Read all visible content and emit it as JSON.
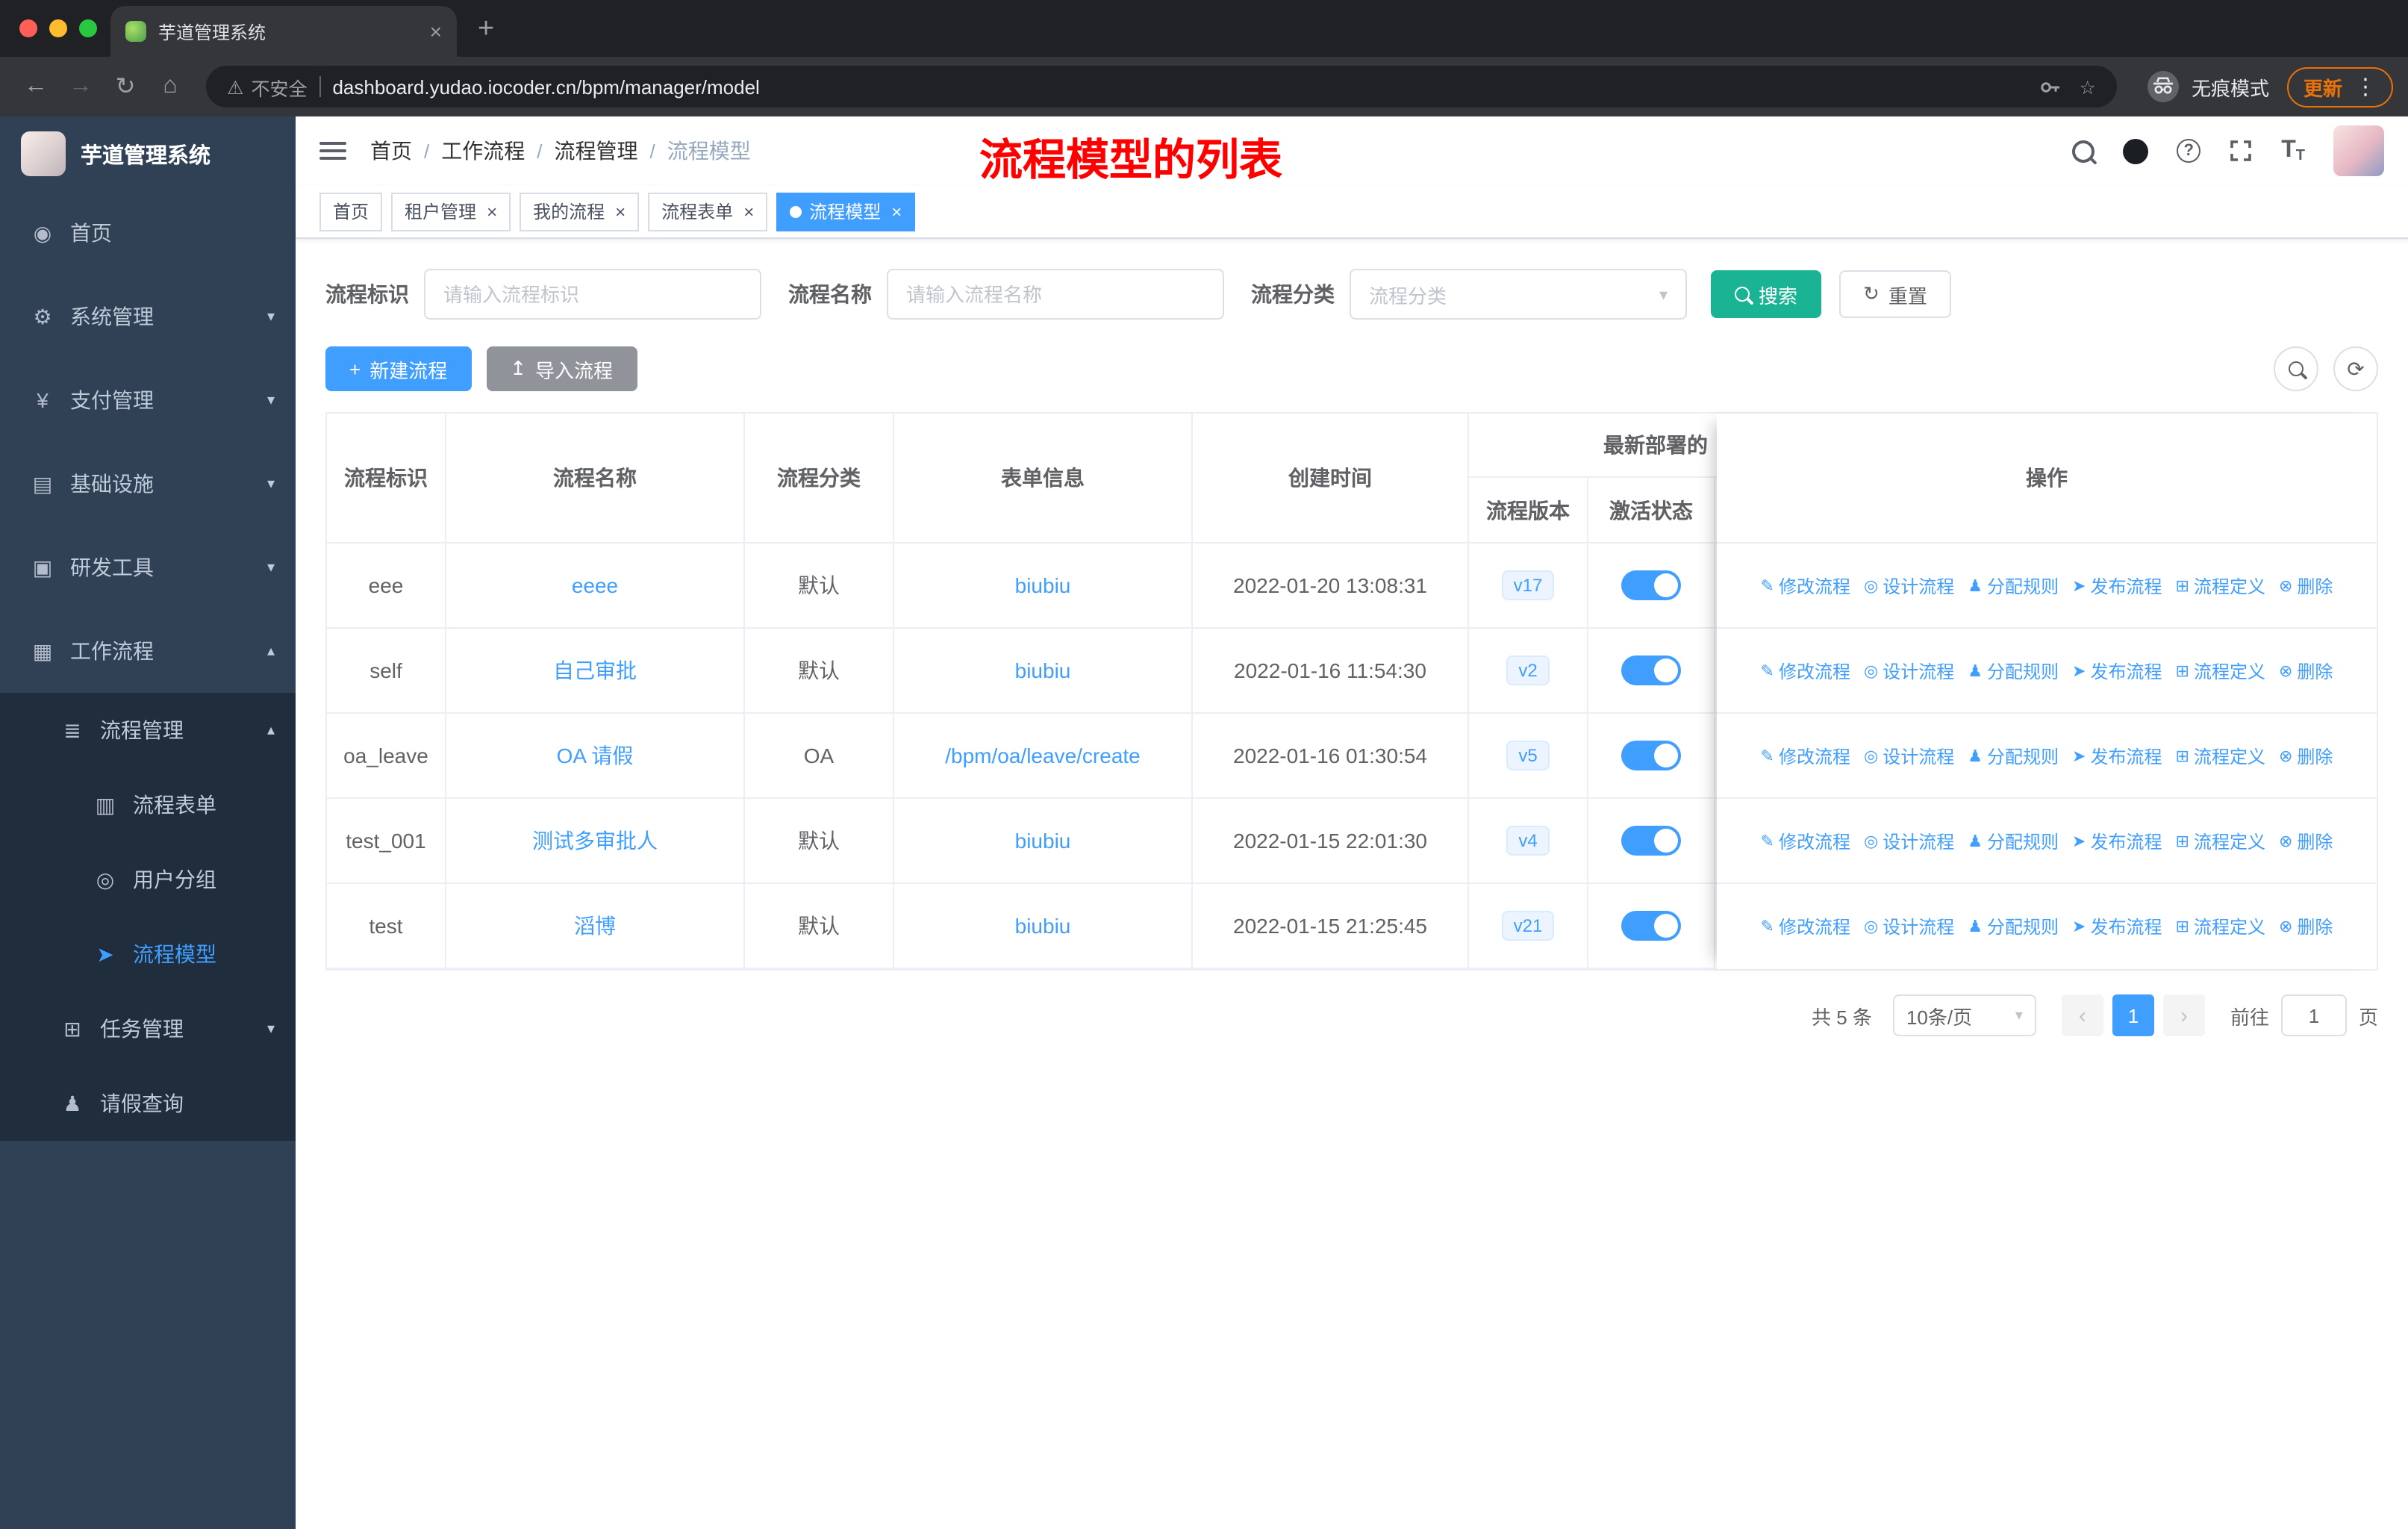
{
  "colors": {
    "accent": "#409eff",
    "search_button": "#1ab394",
    "annotation_red": "#ff0000",
    "sidebar_bg": "#304156",
    "sidebar_nested_bg": "#1f2d3d",
    "toggle_on": "#409eff",
    "tag_active": "#409eff"
  },
  "icons": {
    "dashboard": "◉",
    "gear": "⚙",
    "payment": "¥",
    "infrastructure": "▤",
    "devtools": "▣",
    "workflow": "▦",
    "process_management": "≣",
    "form": "▥",
    "user_group": "◎",
    "model": "➤",
    "task": "⊞",
    "person": "♟",
    "chevron_down": "▾",
    "chevron_up": "▴",
    "edit": "✎",
    "design": "◎",
    "assign": "♟",
    "publish": "➤",
    "definition": "⊞",
    "delete": "⊗",
    "plus": "+",
    "upload": "↥",
    "refresh": "⟳",
    "reset": "↻",
    "back": "←",
    "forward": "→",
    "reload": "↻",
    "home": "⌂",
    "warning": "⚠",
    "star": "☆",
    "dots": "⋮",
    "close": "×",
    "caret": "▾",
    "prev": "‹",
    "next": "›",
    "new_tab": "+",
    "question": "?",
    "font_size": "T"
  },
  "browser": {
    "tab_title": "芋道管理系统",
    "security_label": "不安全",
    "url": "dashboard.yudao.iocoder.cn/bpm/manager/model",
    "incognito_label": "无痕模式",
    "update_label": "更新"
  },
  "sidebar": {
    "app_title": "芋道管理系统",
    "menu": [
      {
        "label": "首页"
      },
      {
        "label": "系统管理"
      },
      {
        "label": "支付管理"
      },
      {
        "label": "基础设施"
      },
      {
        "label": "研发工具"
      },
      {
        "label": "工作流程"
      },
      {
        "label": "流程管理"
      },
      {
        "label": "流程表单"
      },
      {
        "label": "用户分组"
      },
      {
        "label": "流程模型"
      },
      {
        "label": "任务管理"
      },
      {
        "label": "请假查询"
      }
    ]
  },
  "header": {
    "breadcrumb": [
      "首页",
      "工作流程",
      "流程管理",
      "流程模型"
    ],
    "annotation": "流程模型的列表"
  },
  "tags": [
    {
      "label": "首页"
    },
    {
      "label": "租户管理"
    },
    {
      "label": "我的流程"
    },
    {
      "label": "流程表单"
    },
    {
      "label": "流程模型"
    }
  ],
  "filters": {
    "key_label": "流程标识",
    "key_placeholder": "请输入流程标识",
    "name_label": "流程名称",
    "name_placeholder": "请输入流程名称",
    "category_label": "流程分类",
    "category_placeholder": "流程分类",
    "search_label": "搜索",
    "reset_label": "重置"
  },
  "toolbar": {
    "create_label": "新建流程",
    "import_label": "导入流程"
  },
  "table": {
    "headers": {
      "id": "流程标识",
      "name": "流程名称",
      "category": "流程分类",
      "form": "表单信息",
      "created": "创建时间",
      "deploy_group": "最新部署的",
      "version": "流程版本",
      "status": "激活状态",
      "actions": "操作"
    },
    "rows": [
      {
        "id": "eee",
        "name": "eeee",
        "category": "默认",
        "form": "biubiu",
        "created": "2022-01-20 13:08:31",
        "version": "v17",
        "active": true
      },
      {
        "id": "self",
        "name": "自己审批",
        "category": "默认",
        "form": "biubiu",
        "created": "2022-01-16 11:54:30",
        "version": "v2",
        "active": true
      },
      {
        "id": "oa_leave",
        "name": "OA 请假",
        "category": "OA",
        "form": "/bpm/oa/leave/create",
        "created": "2022-01-16 01:30:54",
        "version": "v5",
        "active": true
      },
      {
        "id": "test_001",
        "name": "测试多审批人",
        "category": "默认",
        "form": "biubiu",
        "created": "2022-01-15 22:01:30",
        "version": "v4",
        "active": true
      },
      {
        "id": "test",
        "name": "滔博",
        "category": "默认",
        "form": "biubiu",
        "created": "2022-01-15 21:25:45",
        "version": "v21",
        "active": true
      }
    ],
    "row_actions": [
      "修改流程",
      "设计流程",
      "分配规则",
      "发布流程",
      "流程定义",
      "删除"
    ]
  },
  "pagination": {
    "total": "共 5 条",
    "page_size": "10条/页",
    "current": "1",
    "goto_label": "前往",
    "goto_value": "1",
    "unit": "页"
  }
}
